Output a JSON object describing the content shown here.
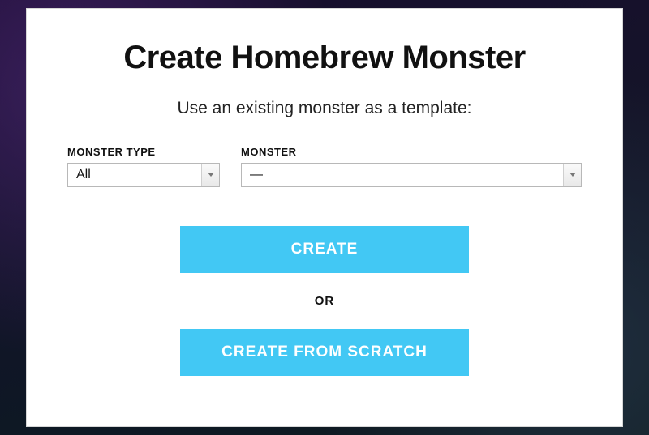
{
  "title": "Create Homebrew Monster",
  "subtitle": "Use an existing monster as a template:",
  "fields": {
    "monster_type": {
      "label": "MONSTER TYPE",
      "value": "All"
    },
    "monster": {
      "label": "MONSTER",
      "value": "—"
    }
  },
  "buttons": {
    "create": "CREATE",
    "create_from_scratch": "CREATE FROM SCRATCH"
  },
  "divider_text": "OR",
  "colors": {
    "accent": "#42c8f4"
  }
}
